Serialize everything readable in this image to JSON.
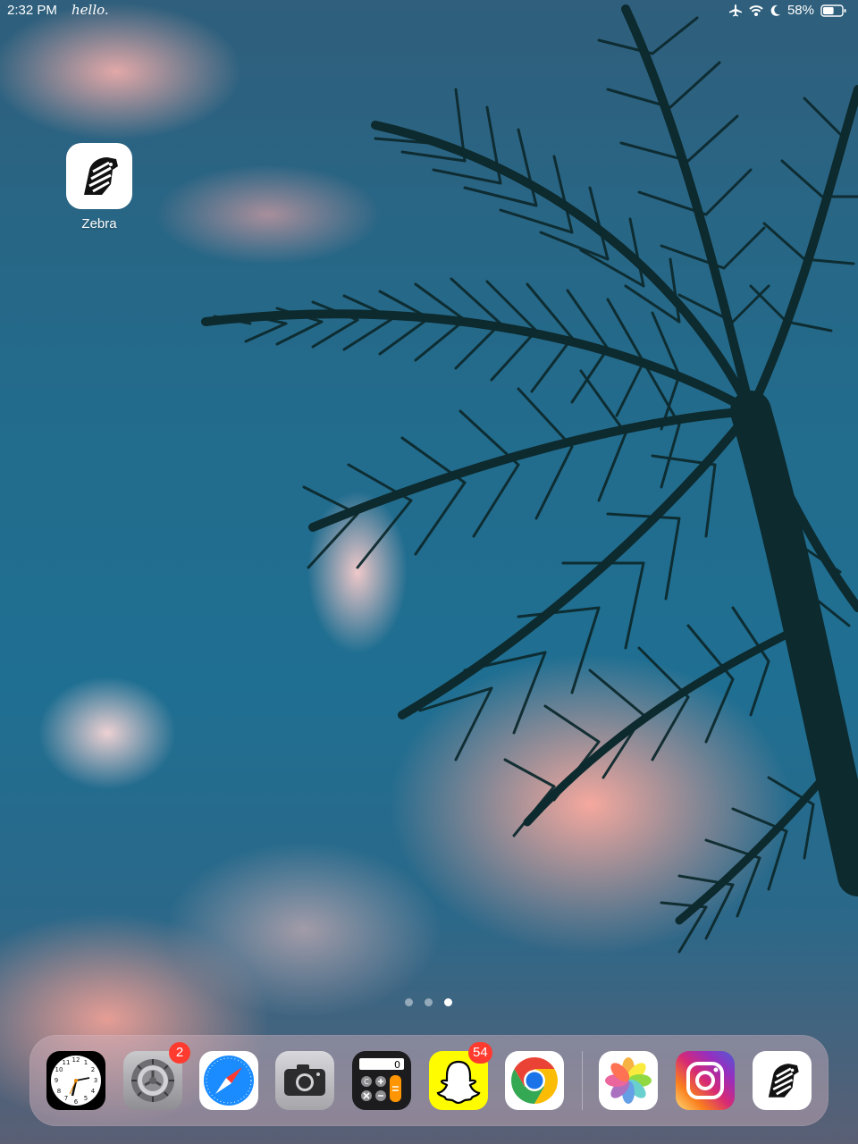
{
  "status_bar": {
    "time": "2:32 PM",
    "greeting": "hello.",
    "battery_percent": "58%",
    "battery_level": 0.58,
    "icons": [
      "airplane-mode-icon",
      "wifi-icon",
      "do-not-disturb-icon",
      "battery-icon"
    ]
  },
  "home_apps": [
    {
      "label": "Zebra",
      "icon": "zebra-icon"
    }
  ],
  "page_dots": {
    "count": 3,
    "active_index": 2
  },
  "dock": {
    "apps": [
      {
        "name": "Clock",
        "icon": "clock-icon"
      },
      {
        "name": "Settings",
        "icon": "gear-icon",
        "badge": "2"
      },
      {
        "name": "Safari",
        "icon": "compass-icon"
      },
      {
        "name": "Camera",
        "icon": "camera-icon"
      },
      {
        "name": "Calculator",
        "icon": "calculator-icon",
        "display": "0"
      },
      {
        "name": "Snapchat",
        "icon": "ghost-icon",
        "badge": "54"
      },
      {
        "name": "Chrome",
        "icon": "chrome-icon"
      },
      {
        "name": "Photos",
        "icon": "photos-flower-icon"
      },
      {
        "name": "Instagram",
        "icon": "instagram-icon"
      },
      {
        "name": "Zebra",
        "icon": "zebra-icon"
      }
    ]
  },
  "colors": {
    "badge": "#ff3b30",
    "snapchat_yellow": "#fffc00",
    "sky_blue": "#1f6f92",
    "cloud_pink": "#fcaa9e"
  }
}
